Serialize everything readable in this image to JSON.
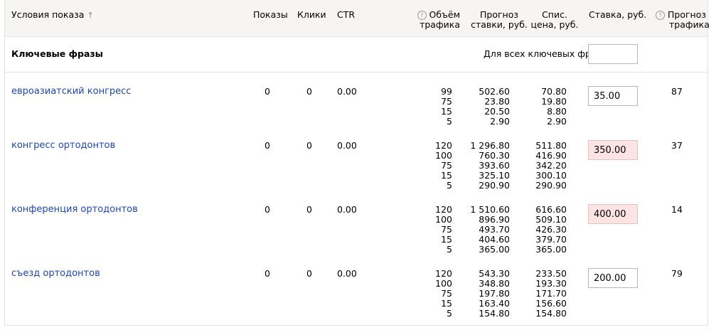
{
  "header": {
    "conditions": "Условия показа",
    "sort_arrow": "↑",
    "impressions": "Показы",
    "clicks": "Клики",
    "ctr": "CTR",
    "traffic_volume_l1": "Объём",
    "traffic_volume_l2": "трафика",
    "forecast_bid_l1": "Прогноз",
    "forecast_bid_l2": "ставки, руб.",
    "charge_price_l1": "Спис.",
    "charge_price_l2": "цена, руб.",
    "bid": "Ставка, руб.",
    "forecast_traffic_l1": "Прогноз",
    "forecast_traffic_l2": "трафика",
    "hint_symbol": "?"
  },
  "group": {
    "title": "Ключевые фразы",
    "all_label": "Для всех ключевых фраз:",
    "all_value": ""
  },
  "rows": [
    {
      "phrase": "евроазиатский конгресс",
      "impressions": "0",
      "clicks": "0",
      "ctr": "0.00",
      "volumes": [
        "99",
        "75",
        "15",
        "5"
      ],
      "forecast": [
        "502.60",
        "23.80",
        "20.50",
        "2.90"
      ],
      "charge": [
        "70.80",
        "19.80",
        "8.80",
        "2.90"
      ],
      "bid": "35.00",
      "bid_warn": false,
      "traffic": "87"
    },
    {
      "phrase": "конгресс ортодонтов",
      "impressions": "0",
      "clicks": "0",
      "ctr": "0.00",
      "volumes": [
        "120",
        "100",
        "75",
        "15",
        "5"
      ],
      "forecast": [
        "1 296.80",
        "760.30",
        "393.60",
        "325.10",
        "290.90"
      ],
      "charge": [
        "511.80",
        "416.90",
        "342.20",
        "300.10",
        "290.90"
      ],
      "bid": "350.00",
      "bid_warn": true,
      "traffic": "37"
    },
    {
      "phrase": "конференция ортодонтов",
      "impressions": "0",
      "clicks": "0",
      "ctr": "0.00",
      "volumes": [
        "120",
        "100",
        "75",
        "15",
        "5"
      ],
      "forecast": [
        "1 510.60",
        "896.90",
        "493.70",
        "404.60",
        "365.00"
      ],
      "charge": [
        "616.60",
        "509.10",
        "426.30",
        "379.70",
        "365.00"
      ],
      "bid": "400.00",
      "bid_warn": true,
      "traffic": "14"
    },
    {
      "phrase": "съезд ортодонтов",
      "impressions": "0",
      "clicks": "0",
      "ctr": "0.00",
      "volumes": [
        "120",
        "100",
        "75",
        "15",
        "5"
      ],
      "forecast": [
        "543.30",
        "348.80",
        "197.80",
        "163.40",
        "154.80"
      ],
      "charge": [
        "233.50",
        "193.30",
        "171.70",
        "156.60",
        "154.80"
      ],
      "bid": "200.00",
      "bid_warn": false,
      "traffic": "79"
    }
  ],
  "colors": {
    "link": "#1f46b4",
    "header_bg": "#f6f5f3",
    "warn_bg": "#fde3e3",
    "border": "#e2e2e2"
  }
}
